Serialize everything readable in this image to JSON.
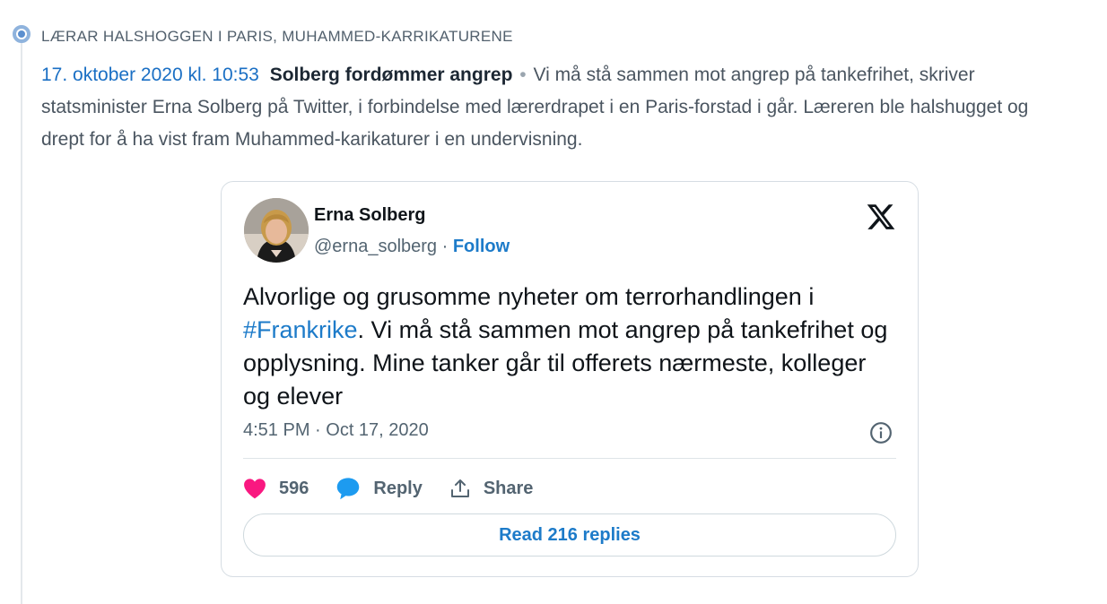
{
  "topic_tags": "LÆRAR HALSHOGGEN I PARIS,  MUHAMMED-KARRIKATURENE",
  "entry": {
    "time": "17. oktober 2020 kl. 10:53",
    "title": "Solberg fordømmer angrep",
    "separator": "•",
    "body": "Vi må stå sammen mot angrep på tankefrihet, skriver statsminister Erna Solberg på Twitter, i forbindelse med lærerdrapet i en Paris-forstad i går. Læreren ble halshugget og drept for å ha vist fram Muhammed-karikaturer i en undervisning."
  },
  "tweet": {
    "author": "Erna Solberg",
    "handle": "@erna_solberg",
    "handle_sep": " · ",
    "follow_label": "Follow",
    "text_before": "Alvorlige og grusomme nyheter om terrorhandlingen i ",
    "hashtag": "#Frankrike",
    "text_after": ". Vi må stå sammen mot angrep på tankefrihet og opplysning. Mine tanker går til offerets nærmeste, kolleger og elever",
    "timestamp": "4:51 PM · Oct 17, 2020",
    "likes": "596",
    "reply_label": "Reply",
    "share_label": "Share",
    "read_replies_label": "Read 216 replies",
    "icons": {
      "brand": "x-logo-icon",
      "info": "info-icon",
      "like": "heart-icon",
      "reply": "speech-bubble-icon",
      "share": "share-icon"
    }
  },
  "colors": {
    "link": "#1a6fc4",
    "heart": "#f91880",
    "accent": "#1d7bc9"
  }
}
